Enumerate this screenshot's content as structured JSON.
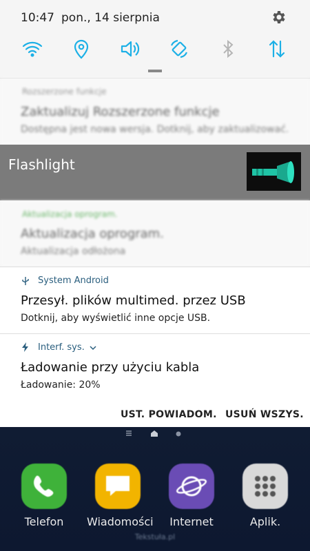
{
  "status": {
    "time": "10:47",
    "date": "pon., 14 sierpnia"
  },
  "quick_toggles": [
    {
      "icon": "wifi-icon"
    },
    {
      "icon": "location-icon"
    },
    {
      "icon": "sound-icon"
    },
    {
      "icon": "auto-rotate-icon"
    },
    {
      "icon": "bluetooth-icon"
    },
    {
      "icon": "mobile-data-icon"
    }
  ],
  "blurred": {
    "one": {
      "app": "Rozszerzone funkcje",
      "title": "Zaktualizuj Rozszerzone funkcje",
      "body": "Dostępna jest nowa wersja. Dotknij, aby zaktualizować."
    },
    "two": {
      "app": "Aktualizacja oprogram.",
      "title": "Aktualizacja oprogram.",
      "body": "Aktualizacja odłożona"
    }
  },
  "flashlight": {
    "title": "Flashlight"
  },
  "notifications": [
    {
      "app": "System Android",
      "title": "Przesył. plików multimed. przez USB",
      "body": "Dotknij, aby wyświetlić inne opcje USB."
    },
    {
      "app": "Interf. sys.",
      "title": "Ładowanie przy użyciu kabla",
      "body": "Ładowanie: 20%"
    }
  ],
  "actions": {
    "settings": "UST. POWIADOM.",
    "clear": "USUŃ WSZYS."
  },
  "home": {
    "apps": [
      {
        "label": "Telefon",
        "color": "#3fb23a"
      },
      {
        "label": "Wiadomości",
        "color": "#f2b400"
      },
      {
        "label": "Internet",
        "color": "#6a4cb5"
      },
      {
        "label": "Aplik.",
        "color": "#d9d9d9"
      }
    ],
    "watermark": "Tekstuła.pl"
  },
  "colors": {
    "accent": "#1cb0e6",
    "panel": "#f5f5f5",
    "flash_bar": "#7b7b7b"
  }
}
